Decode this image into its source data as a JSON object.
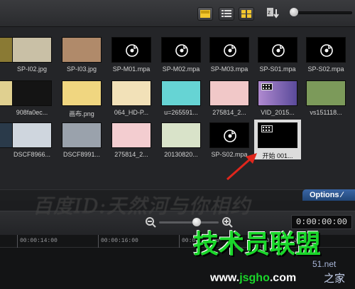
{
  "toolbar": {
    "view_icons": [
      "list-detail-icon",
      "list-icon",
      "grid-icon"
    ],
    "sort_icon": "sort-icon"
  },
  "library": {
    "rows": [
      [
        {
          "label": "",
          "kind": "image",
          "bg": "#8a7a34"
        },
        {
          "label": "SP-I02.jpg",
          "kind": "image",
          "bg": "#c9c0a6"
        },
        {
          "label": "SP-I03.jpg",
          "kind": "image",
          "bg": "#b08a6a"
        },
        {
          "label": "SP-M01.mpa",
          "kind": "music"
        },
        {
          "label": "SP-M02.mpa",
          "kind": "music"
        },
        {
          "label": "SP-M03.mpa",
          "kind": "music"
        },
        {
          "label": "SP-S01.mpa",
          "kind": "music"
        },
        {
          "label": "SP-S02.mpa",
          "kind": "music"
        }
      ],
      [
        {
          "label": "",
          "kind": "image",
          "bg": "#e0d090"
        },
        {
          "label": "908fa0ec...",
          "kind": "image",
          "bg": "#141414"
        },
        {
          "label": "画布.png",
          "kind": "image",
          "bg": "#f0d680"
        },
        {
          "label": "064_HD-P...",
          "kind": "image",
          "bg": "#f2e1b8"
        },
        {
          "label": "u=265591...",
          "kind": "image",
          "bg": "#66d4d4"
        },
        {
          "label": "275814_2...",
          "kind": "image",
          "bg": "#f1c8c8"
        },
        {
          "label": "VID_2015...",
          "kind": "video",
          "bg": "#7a6ab8"
        },
        {
          "label": "vs151118...",
          "kind": "image",
          "bg": "#7c9a5a"
        }
      ],
      [
        {
          "label": "",
          "kind": "image",
          "bg": "#2a3a4a"
        },
        {
          "label": "DSCF8966...",
          "kind": "image",
          "bg": "#cfd6de"
        },
        {
          "label": "DSCF8991...",
          "kind": "image",
          "bg": "#9aa2ac"
        },
        {
          "label": "275814_2...",
          "kind": "image",
          "bg": "#f3cdd0"
        },
        {
          "label": "20130820...",
          "kind": "image",
          "bg": "#d9e3c9"
        },
        {
          "label": "SP-S02.mpa",
          "kind": "music"
        },
        {
          "label": "开始 001...",
          "kind": "video",
          "bg": "#000",
          "selected": true
        }
      ]
    ]
  },
  "options_label": "Options",
  "timeline": {
    "timecode": "0:00:00:00",
    "ruler": [
      "00:00:14:00",
      "00:00:16:00",
      "00:00:18:00",
      "00:00:20:00"
    ]
  },
  "watermark": {
    "top_text": "百度ID:天然河与你相约",
    "brand": "技术员联盟",
    "url_left": "www.",
    "url_mid": "jsgho",
    "url_right": ".com",
    "suffix1": "51.net",
    "suffix2": "之家"
  }
}
